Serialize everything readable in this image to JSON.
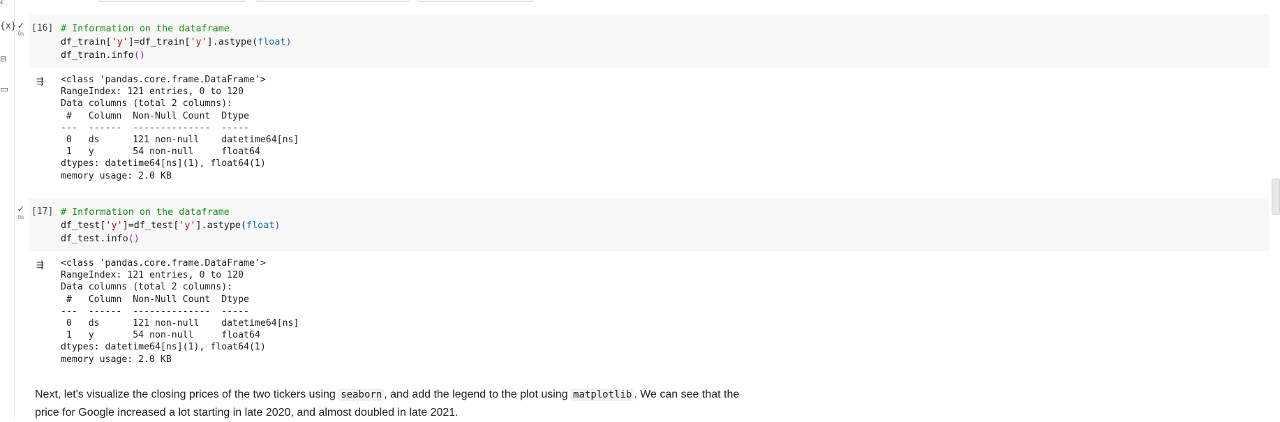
{
  "cells": [
    {
      "exec_count": "[16]",
      "time": "0s",
      "code": {
        "comment": "# Information on the dataframe",
        "line2": {
          "a": "df_train[",
          "s1": "'y'",
          "b": "]=df_train[",
          "s2": "'y'",
          "c": "].astype(",
          "kw": "float",
          "d": ")"
        },
        "line3": {
          "a": "df_train.info",
          "p": "()"
        }
      },
      "output": [
        "<class 'pandas.core.frame.DataFrame'>",
        "RangeIndex: 121 entries, 0 to 120",
        "Data columns (total 2 columns):",
        " #   Column  Non-Null Count  Dtype         ",
        "---  ------  --------------  -----         ",
        " 0   ds      121 non-null    datetime64[ns]",
        " 1   y       54 non-null     float64       ",
        "dtypes: datetime64[ns](1), float64(1)",
        "memory usage: 2.0 KB"
      ]
    },
    {
      "exec_count": "[17]",
      "time": "0s",
      "code": {
        "comment": "# Information on the dataframe",
        "line2": {
          "a": "df_test[",
          "s1": "'y'",
          "b": "]=df_test[",
          "s2": "'y'",
          "c": "].astype(",
          "kw": "float",
          "d": ")"
        },
        "line3": {
          "a": "df_test.info",
          "p": "()"
        }
      },
      "output": [
        "<class 'pandas.core.frame.DataFrame'>",
        "RangeIndex: 121 entries, 0 to 120",
        "Data columns (total 2 columns):",
        " #   Column  Non-Null Count  Dtype         ",
        "---  ------  --------------  -----         ",
        " 0   ds      121 non-null    datetime64[ns]",
        " 1   y       54 non-null     float64       ",
        "dtypes: datetime64[ns](1), float64(1)",
        "memory usage: 2.0 KB"
      ]
    }
  ],
  "markdown": {
    "t1": "Next, let's visualize the closing prices of the two tickers using ",
    "c1": "seaborn",
    "t2": ", and add the legend to the plot using ",
    "c2": "matplotlib",
    "t3": ". We can see that the price for Google increased a lot starting in late 2020, and almost doubled in late 2021."
  },
  "icons": {
    "rail": [
      "chevron-icon",
      "variables-icon",
      "key-icon",
      "folder-icon"
    ],
    "cell_status": "check-icon",
    "output_toggle": "output-collapse-icon"
  },
  "colors": {
    "comment": "#1a8a1a",
    "string": "#a31515",
    "keyword": "#1f6ca8",
    "paren": "#9a2ab0",
    "success": "#188038",
    "code_bg": "#f7f7f7"
  }
}
